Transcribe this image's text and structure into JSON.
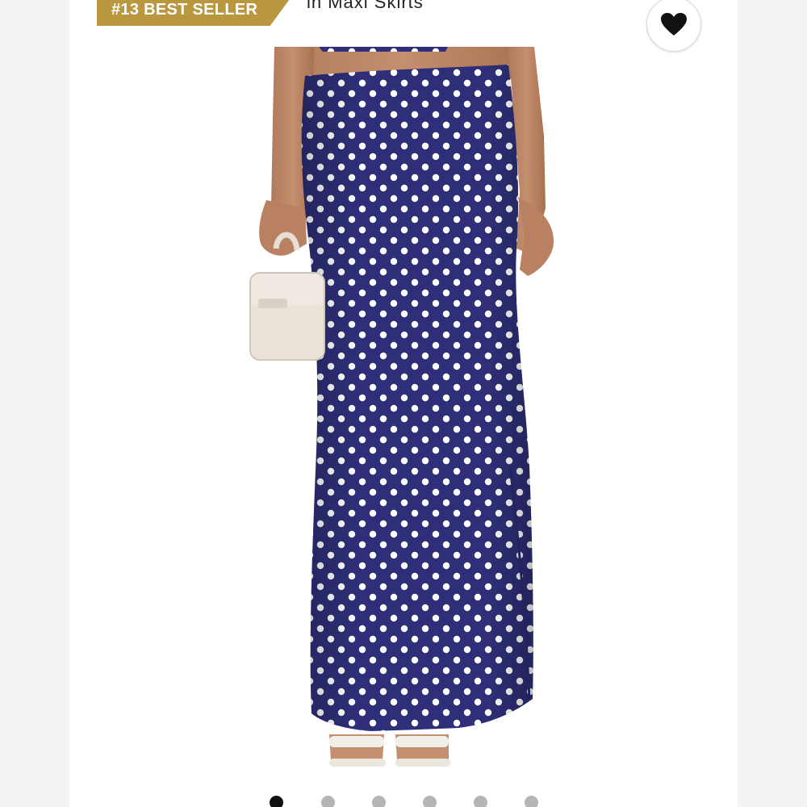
{
  "badge": {
    "label": "#13 BEST SELLER",
    "color": "#b8973f"
  },
  "category": {
    "text": "in Maxi Skirts"
  },
  "wishlist": {
    "icon": "heart-icon"
  },
  "product_image": {
    "alt": "Navy polka dot maxi skirt",
    "skirt_color": "#2e2f78",
    "dot_color": "#ffffff",
    "bag_color": "#e9e3da"
  },
  "carousel": {
    "total": 6,
    "active_index": 0,
    "active_color": "#111111",
    "inactive_color": "#b5b5b5"
  }
}
